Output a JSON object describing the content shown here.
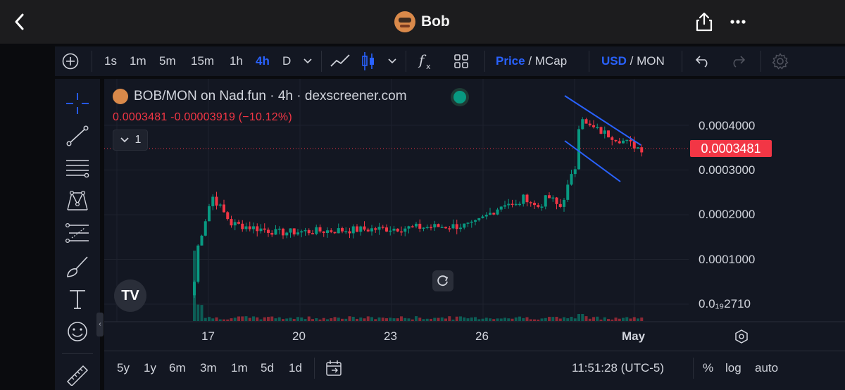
{
  "header": {
    "title": "Bob"
  },
  "toolbar": {
    "timeframes": [
      "1s",
      "1m",
      "5m",
      "15m",
      "1h",
      "4h",
      "D"
    ],
    "active_timeframe": "4h",
    "price_label": "Price",
    "mcap_label": "MCap",
    "usd_label": "USD",
    "mon_label": "MON",
    "slash": "/"
  },
  "chart": {
    "symbol_title": "BOB/MON on Nad.fun · 4h · dexscreener.com",
    "ohlc_change": "0.0003481  -0.00003919 (−10.12%)",
    "collapse_count": "1",
    "current_price": "0.0003481",
    "y_ticks": [
      "0.0004000",
      "0.0003000",
      "0.0002000",
      "0.0001000",
      "0.0₁₉2710"
    ],
    "x_ticks": [
      "17",
      "20",
      "23",
      "26",
      "May"
    ],
    "tv_logo": "TV",
    "colors": {
      "up": "#089981",
      "down": "#f23645",
      "trendline": "#2962ff",
      "accent": "#2962ff"
    }
  },
  "bottom": {
    "ranges": [
      "5y",
      "1y",
      "6m",
      "3m",
      "1m",
      "5d",
      "1d"
    ],
    "time": "11:51:28 (UTC-5)",
    "percent": "%",
    "log": "log",
    "auto": "auto"
  },
  "chart_data": {
    "type": "candlestick",
    "interval": "4h",
    "x_labels": [
      "17",
      "20",
      "23",
      "26",
      "May"
    ],
    "ylim": [
      3e-05,
      0.00047
    ],
    "last_price": 0.0003481,
    "change": -3.919e-05,
    "change_pct": -10.12,
    "volume": "bars",
    "trendlines": "descending channel (two blue lines)"
  }
}
